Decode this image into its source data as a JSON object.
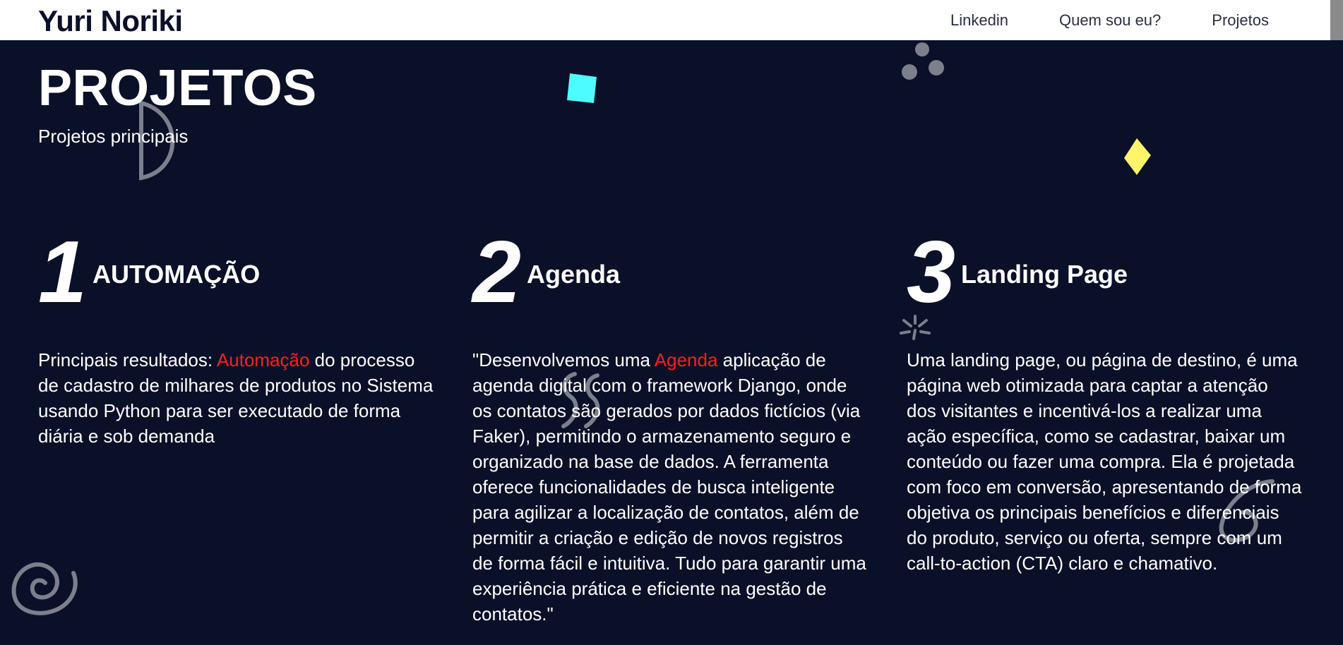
{
  "navbar": {
    "brand": "Yuri Noriki",
    "links": [
      "Linkedin",
      "Quem sou eu?",
      "Projetos"
    ]
  },
  "hero": {
    "title": "PROJETOS",
    "subtitle": "Projetos principais"
  },
  "projects": [
    {
      "number": "1",
      "title": "AUTOMAÇÃO",
      "desc_before": "Principais resultados: ",
      "desc_highlight": "Automação",
      "desc_after": " do processo de cadastro de milhares de produtos no Sistema usando Python para ser executado de forma diária e sob demanda"
    },
    {
      "number": "2",
      "title": "Agenda",
      "desc_before": "\"Desenvolvemos uma ",
      "desc_highlight": "Agenda",
      "desc_after": " aplicação de agenda digital com o framework Django, onde os contatos são gerados por dados fictícios (via Faker), permitindo o armazenamento seguro e organizado na base de dados. A ferramenta oferece funcionalidades de busca inteligente para agilizar a localização de contatos, além de permitir a criação e edição de novos registros de forma fácil e intuitiva. Tudo para garantir uma experiência prática e eficiente na gestão de contatos.\""
    },
    {
      "number": "3",
      "title": "Landing Page",
      "desc_before": "Uma landing page, ou página de destino, é uma página web otimizada para captar a atenção dos visitantes e incentivá-los a realizar uma ação específica, como se cadastrar, baixar um conteúdo ou fazer uma compra. Ela é projetada com foco em conversão, apresentando de forma objetiva os principais benefícios e diferenciais do produto, serviço ou oferta, sempre com um call-to-action (CTA) claro e chamativo.",
      "desc_highlight": "",
      "desc_after": ""
    }
  ],
  "colors": {
    "background": "#0b1029",
    "navbar": "#ffffff",
    "highlight": "#ff1e1e",
    "cyan_shape": "#4dfcff",
    "yellow_shape": "#fff46b",
    "doodle": "#7c7f8c"
  }
}
